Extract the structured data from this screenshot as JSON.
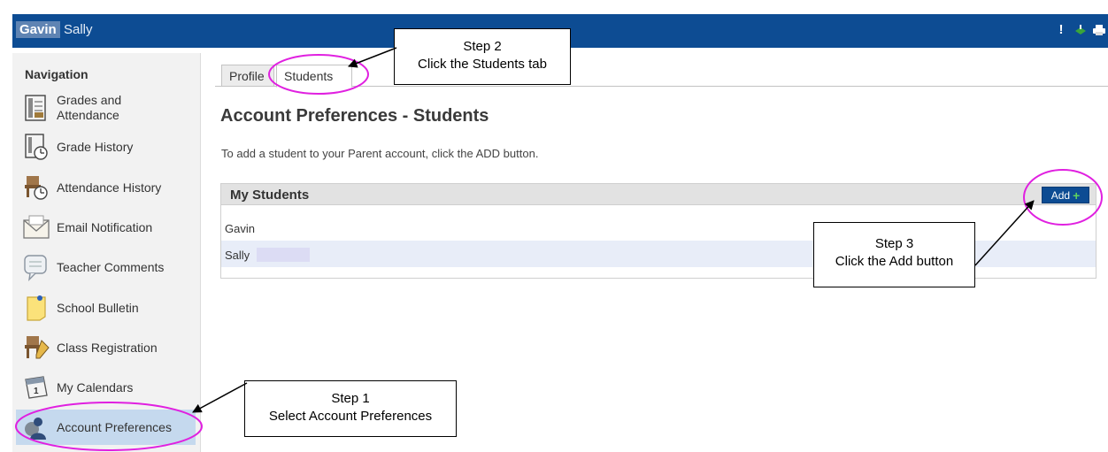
{
  "header": {
    "active_student": "Gavin",
    "other_student": "Sally",
    "alert_icon_text": "!",
    "bg_color": "#0d4c93"
  },
  "icons": {
    "top": [
      "alert-icon",
      "green-hat-icon",
      "print-icon"
    ],
    "nav": [
      "gradebook-icon",
      "grade-history-icon",
      "attendance-history-icon",
      "envelope-icon",
      "comment-icon",
      "bulletin-icon",
      "registration-icon",
      "calendar-icon",
      "account-icon"
    ]
  },
  "sidebar": {
    "title": "Navigation",
    "items": [
      {
        "label": "Grades and Attendance"
      },
      {
        "label": "Grade History"
      },
      {
        "label": "Attendance History"
      },
      {
        "label": "Email Notification"
      },
      {
        "label": "Teacher Comments"
      },
      {
        "label": "School Bulletin"
      },
      {
        "label": "Class Registration"
      },
      {
        "label": "My Calendars"
      },
      {
        "label": "Account Preferences"
      }
    ]
  },
  "tabs": [
    {
      "label": "Profile"
    },
    {
      "label": "Students"
    }
  ],
  "main": {
    "title": "Account Preferences - Students",
    "instructions": "To add a student to your Parent account, click the ADD button.",
    "panel_title": "My Students",
    "add_label": "Add",
    "add_symbol": "+",
    "students": [
      "Gavin",
      "Sally"
    ]
  },
  "callouts": {
    "step1": {
      "line1": "Step 1",
      "line2": "Select Account Preferences"
    },
    "step2": {
      "line1": "Step 2",
      "line2": "Click the Students tab"
    },
    "step3": {
      "line1": "Step 3",
      "line2": "Click the Add button"
    }
  },
  "colors": {
    "accent": "#0d4c93",
    "highlight_ellipse": "#e020e0",
    "active_nav": "#c5d9ee"
  }
}
